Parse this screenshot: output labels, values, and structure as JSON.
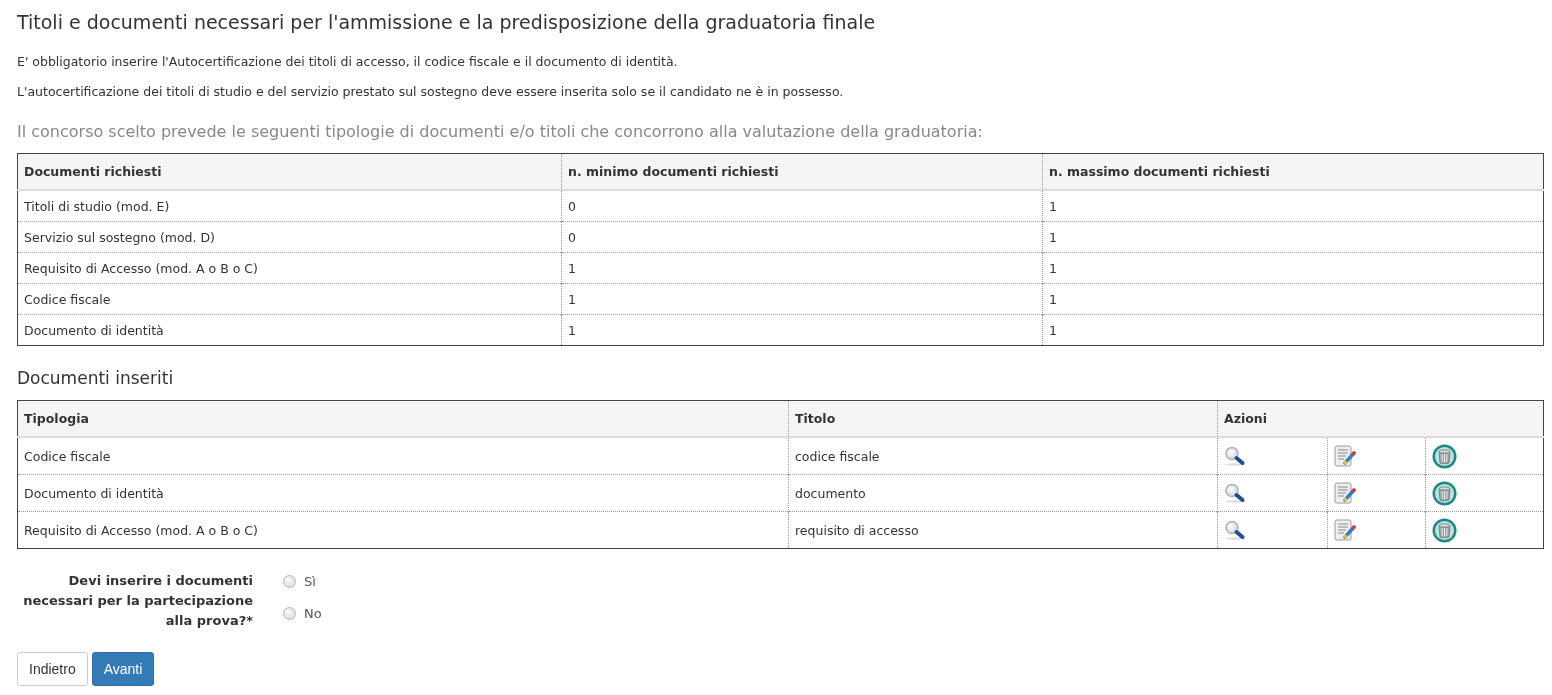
{
  "page_title": "Titoli e documenti necessari per l'ammissione e la predisposizione della graduatoria finale",
  "notes": [
    "E' obbligatorio inserire l'Autocertificazione dei titoli di accesso, il codice fiscale e il documento di identità.",
    "L'autocertificazione dei titoli di studio e del servizio prestato sul sostegno deve essere inserita solo se il candidato ne è in possesso."
  ],
  "requirements": {
    "intro": "Il concorso scelto prevede le seguenti tipologie di documenti e/o titoli che concorrono alla valutazione della graduatoria:",
    "columns": [
      "Documenti richiesti",
      "n. minimo documenti richiesti",
      "n. massimo documenti richiesti"
    ],
    "rows": [
      {
        "document": "Titoli di studio (mod. E)",
        "min": "0",
        "max": "1"
      },
      {
        "document": "Servizio sul sostegno (mod. D)",
        "min": "0",
        "max": "1"
      },
      {
        "document": "Requisito di Accesso (mod. A o B o C)",
        "min": "1",
        "max": "1"
      },
      {
        "document": "Codice fiscale",
        "min": "1",
        "max": "1"
      },
      {
        "document": "Documento di identità",
        "min": "1",
        "max": "1"
      }
    ]
  },
  "inserted_documents": {
    "heading": "Documenti inseriti",
    "columns": [
      "Tipologia",
      "Titolo",
      "Azioni"
    ],
    "rows": [
      {
        "type": "Codice fiscale",
        "title": "codice fiscale",
        "actions": [
          {
            "kind": "view"
          },
          {
            "kind": "edit"
          },
          {
            "kind": "delete"
          }
        ]
      },
      {
        "type": "Documento di identità",
        "title": "documento",
        "actions": [
          {
            "kind": "view"
          },
          {
            "kind": "edit"
          },
          {
            "kind": "delete"
          }
        ]
      },
      {
        "type": "Requisito di Accesso (mod. A o B o C)",
        "title": "requisito di accesso",
        "actions": [
          {
            "kind": "view"
          },
          {
            "kind": "edit"
          },
          {
            "kind": "delete"
          }
        ]
      }
    ]
  },
  "question": {
    "label": "Devi inserire i documenti necessari per la partecipazione alla prova?*",
    "options": [
      {
        "label": "Sì",
        "selected": false
      },
      {
        "label": "No",
        "selected": false
      }
    ]
  },
  "buttons": [
    {
      "label": "Indietro",
      "kind": "default"
    },
    {
      "label": "Avanti",
      "kind": "primary"
    }
  ]
}
